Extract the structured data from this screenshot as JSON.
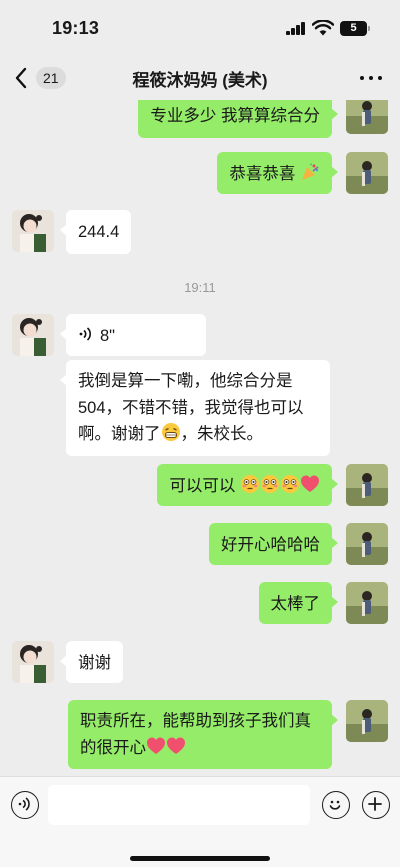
{
  "status_bar": {
    "time": "19:13",
    "battery": "5"
  },
  "nav": {
    "unread_count": "21",
    "title": "程筱沐妈妈 (美术)"
  },
  "messages": {
    "m1": "专业多少  我算算综合分",
    "m2": "恭喜恭喜",
    "m3": "244.4",
    "time_divider": "19:11",
    "voice_duration": "8\"",
    "m5_line1": "我倒是算一下嘞，他综合分是",
    "m5_line2": "504，不错不错，我觉得也可以",
    "m5_line3_a": "啊。谢谢了",
    "m5_line3_b": "，朱校长。",
    "m6": "可以可以",
    "m7": "好开心哈哈哈",
    "m8": "太棒了",
    "m9": "谢谢",
    "m10_line1": "职责所在，能帮助到孩子我们真",
    "m10_line2": "的很开心"
  },
  "emoji_names": [
    "party-popper-emoji",
    "grin-emoji",
    "flushed-emoji",
    "heart-emoji"
  ],
  "colors": {
    "sent_bubble": "#95ec69",
    "received_bubble": "#ffffff",
    "background": "#ededed",
    "heart": "#f0506e"
  },
  "input": {
    "placeholder": ""
  }
}
